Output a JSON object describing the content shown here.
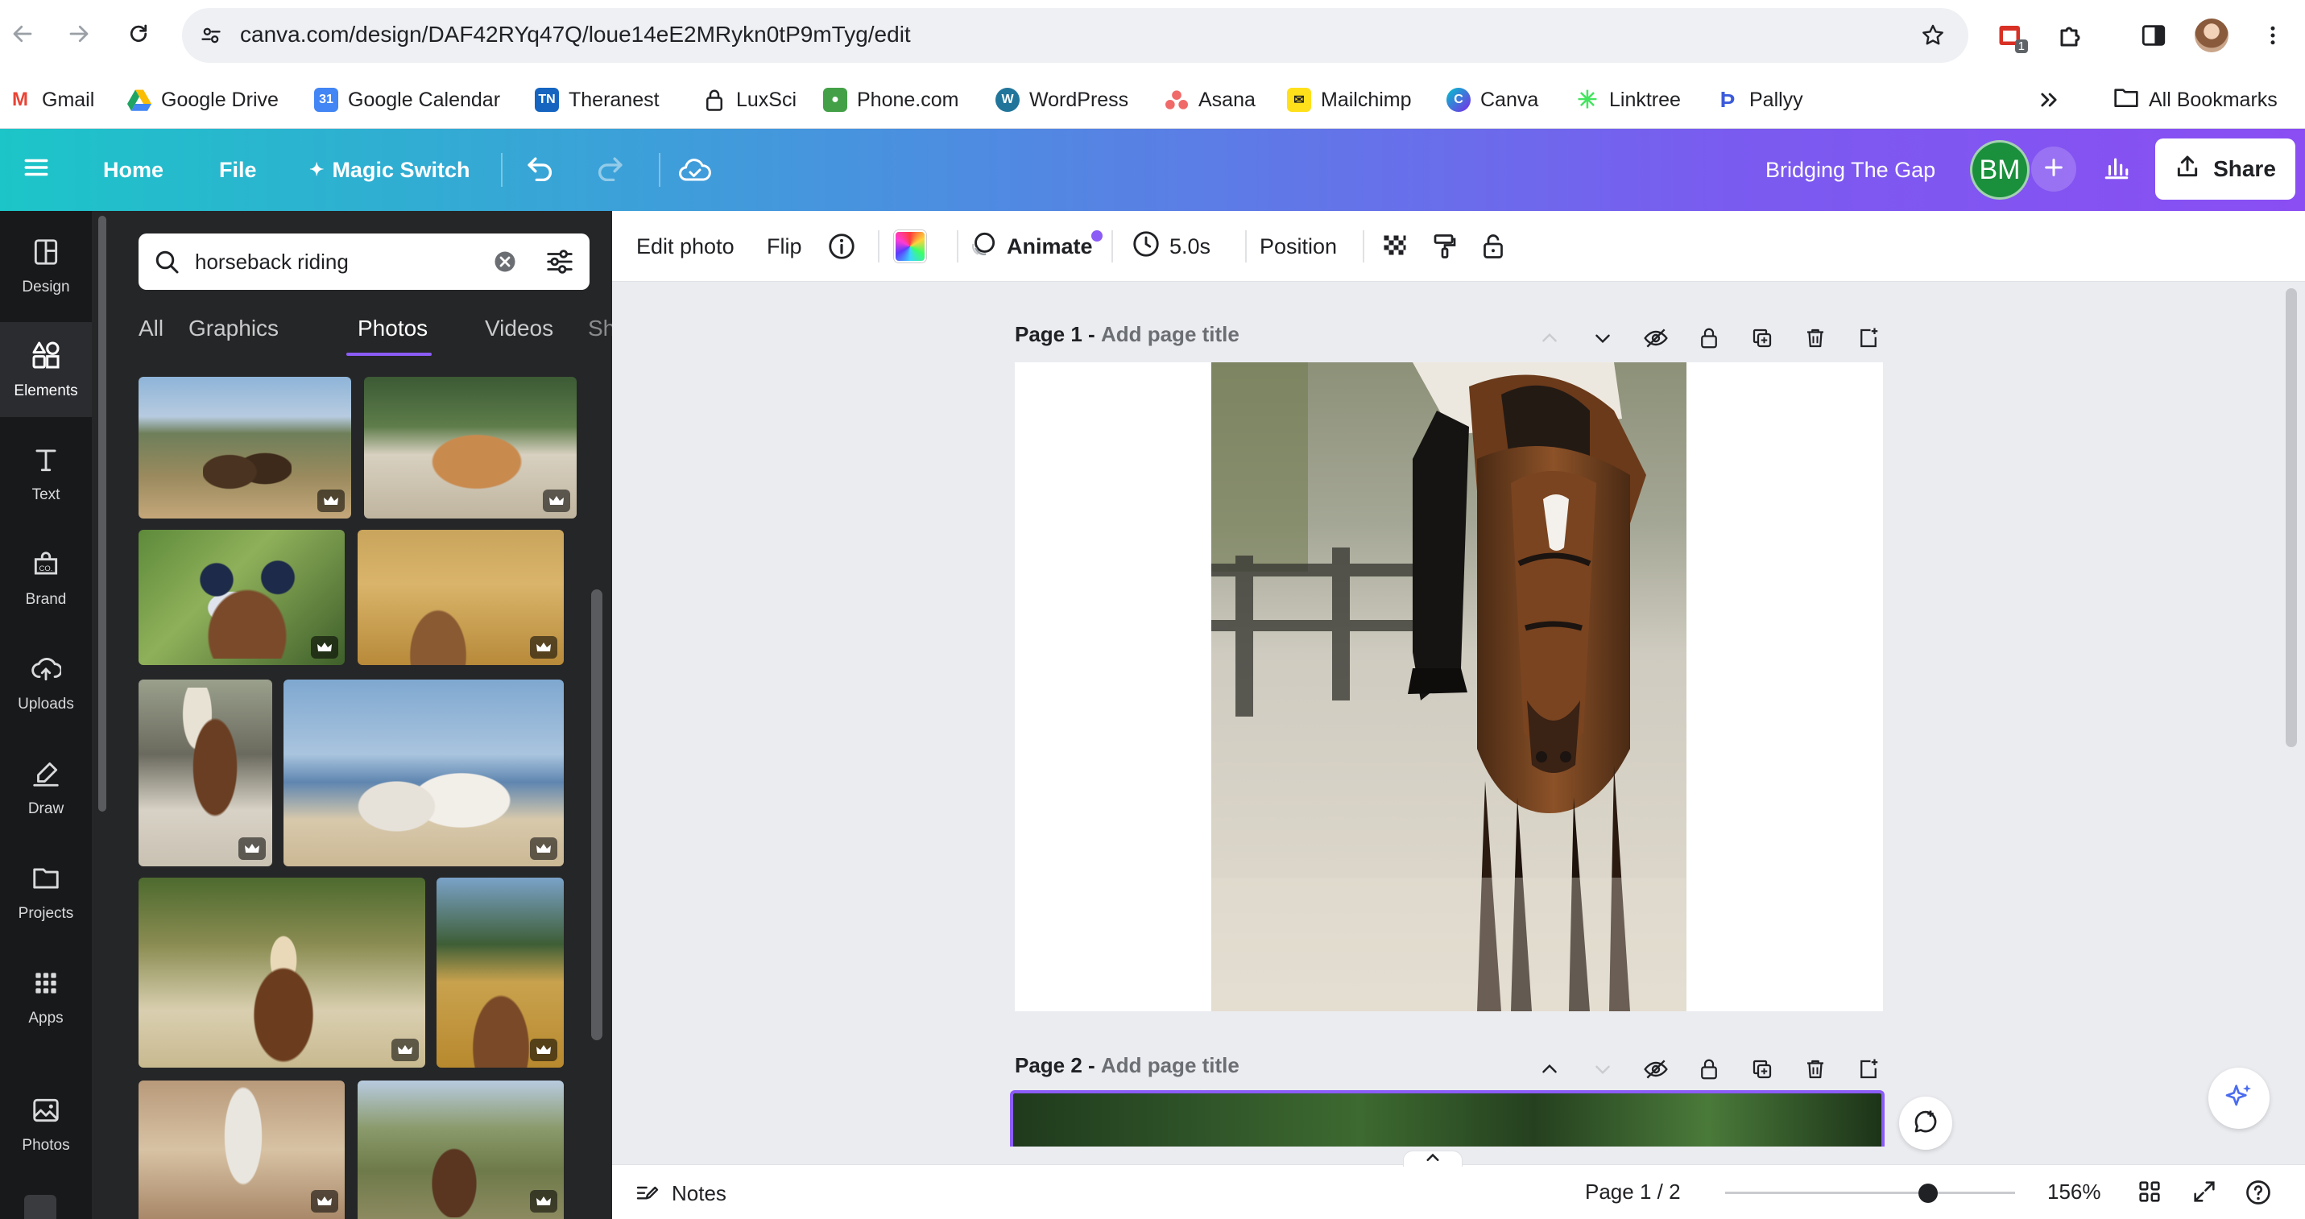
{
  "browser": {
    "url": "canva.com/design/DAF42RYq47Q/loue14eE2MRykn0tP9mTyg/edit",
    "extension_badge": "1",
    "bookmarks": [
      {
        "label": "Gmail",
        "icon": "gmail-icon",
        "color": "#ea4335"
      },
      {
        "label": "Google Drive",
        "icon": "drive-icon",
        "color": "#1fa463"
      },
      {
        "label": "Google Calendar",
        "icon": "calendar-icon",
        "color": "#4285f4"
      },
      {
        "label": "Theranest",
        "icon": "theranest-icon",
        "color": "#1565c0"
      },
      {
        "label": "LuxSci",
        "icon": "lock-icon",
        "color": "#202124"
      },
      {
        "label": "Phone.com",
        "icon": "phone-icon",
        "color": "#43a047"
      },
      {
        "label": "WordPress",
        "icon": "wordpress-icon",
        "color": "#21759b"
      },
      {
        "label": "Asana",
        "icon": "asana-icon",
        "color": "#f06a6a"
      },
      {
        "label": "Mailchimp",
        "icon": "mailchimp-icon",
        "color": "#ffe01b"
      },
      {
        "label": "Canva",
        "icon": "canva-icon",
        "color": "#7d2ae8"
      },
      {
        "label": "Linktree",
        "icon": "linktree-icon",
        "color": "#43e55e"
      },
      {
        "label": "Pallyy",
        "icon": "pallyy-icon",
        "color": "#3b5bdb"
      }
    ],
    "all_bookmarks_label": "All Bookmarks"
  },
  "header": {
    "home": "Home",
    "file": "File",
    "magic_switch": "Magic Switch",
    "design_title": "Bridging The Gap",
    "avatar_initials": "BM",
    "share": "Share"
  },
  "rail": [
    {
      "label": "Design",
      "icon": "design-icon"
    },
    {
      "label": "Elements",
      "icon": "elements-icon",
      "active": true
    },
    {
      "label": "Text",
      "icon": "text-icon"
    },
    {
      "label": "Brand",
      "icon": "brand-icon"
    },
    {
      "label": "Uploads",
      "icon": "uploads-icon"
    },
    {
      "label": "Draw",
      "icon": "draw-icon"
    },
    {
      "label": "Projects",
      "icon": "projects-icon"
    },
    {
      "label": "Apps",
      "icon": "apps-icon"
    },
    {
      "label": "Photos",
      "icon": "photos-icon"
    }
  ],
  "panel": {
    "search_value": "horseback riding",
    "tabs": [
      "All",
      "Graphics",
      "Photos",
      "Videos",
      "Shapes"
    ],
    "active_tab": "Photos"
  },
  "context_toolbar": {
    "edit_photo": "Edit photo",
    "flip": "Flip",
    "animate": "Animate",
    "duration": "5.0s",
    "position": "Position"
  },
  "pages": [
    {
      "label": "Page 1 -",
      "title_placeholder": "Add page title"
    },
    {
      "label": "Page 2 -",
      "title_placeholder": "Add page title"
    }
  ],
  "footer": {
    "notes": "Notes",
    "page_indicator": "Page 1 / 2",
    "zoom": "156%",
    "zoom_fraction": 0.7
  },
  "colors": {
    "accent": "#8b5cf6",
    "header_gradient_start": "#1cc5c8",
    "header_gradient_end": "#8a4ef2",
    "rail_bg": "#18191b",
    "panel_bg": "#252627"
  }
}
